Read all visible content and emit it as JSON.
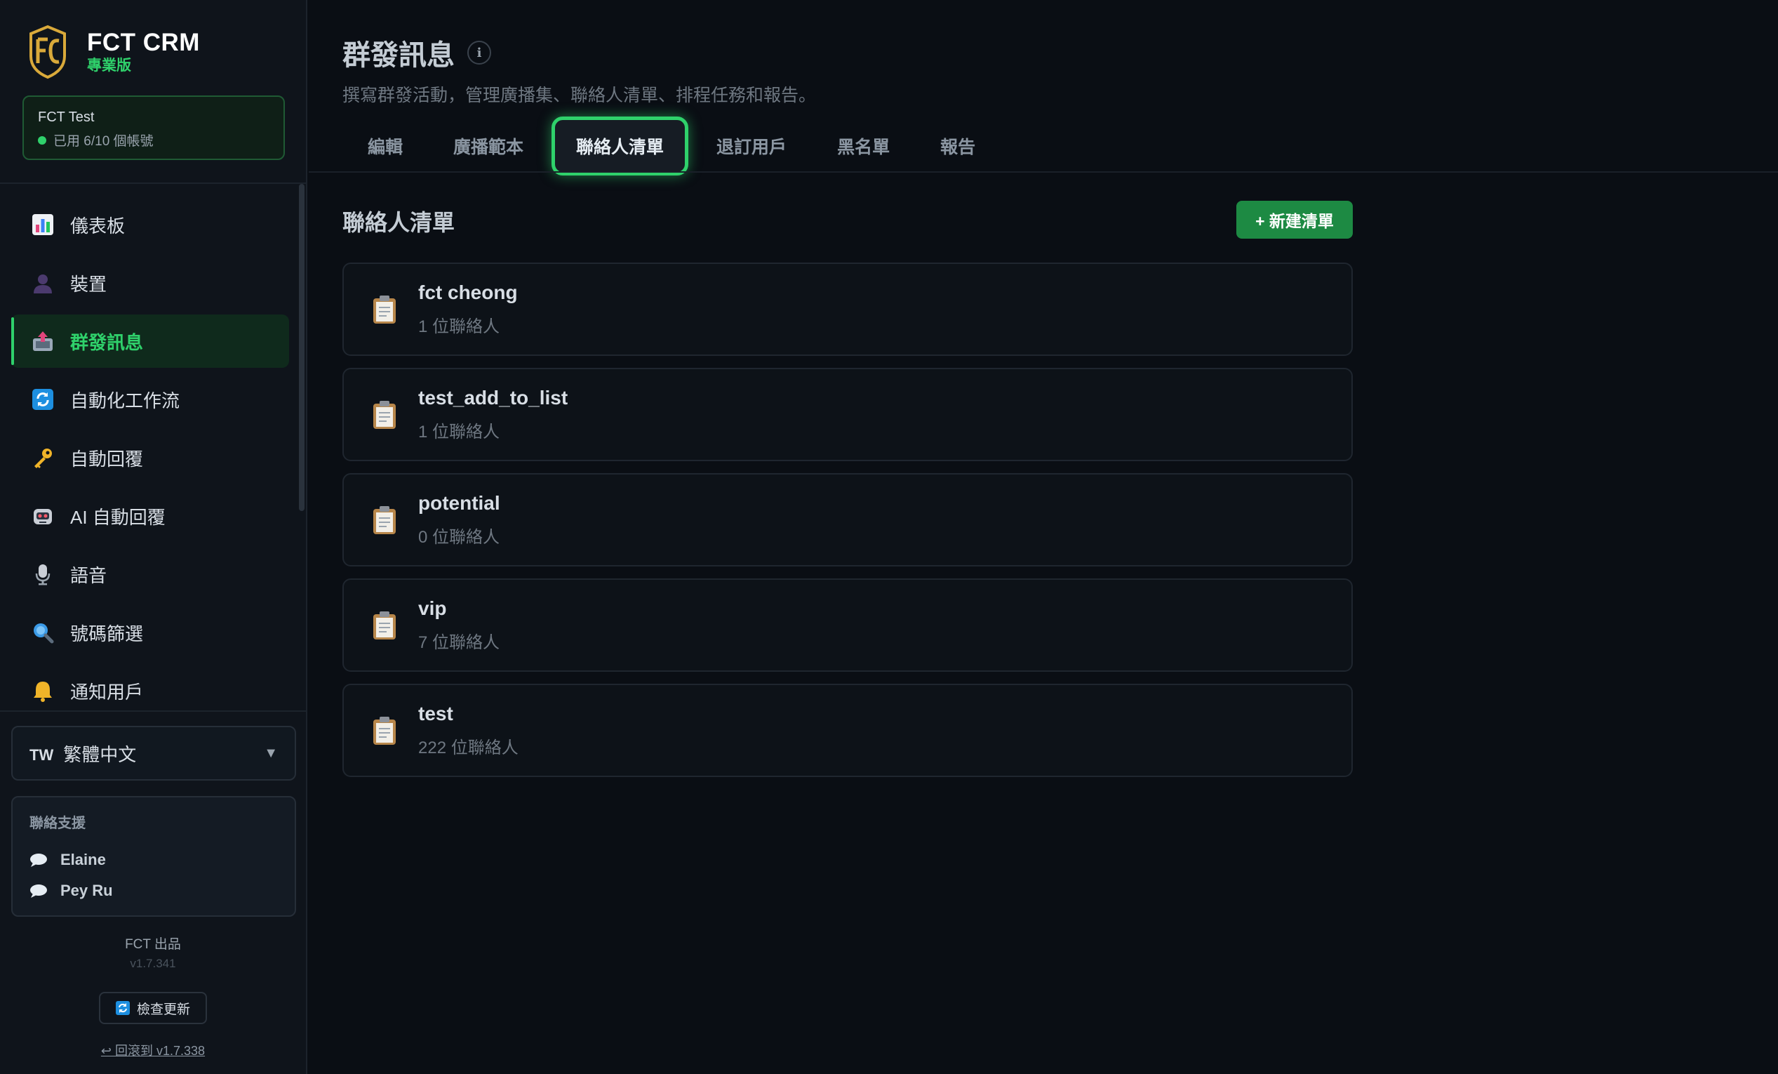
{
  "brand": {
    "title": "FCT CRM",
    "edition": "專業版"
  },
  "account": {
    "name": "FCT Test",
    "status": "已用 6/10 個帳號"
  },
  "nav": [
    {
      "label": "儀表板",
      "icon": "chart-icon"
    },
    {
      "label": "裝置",
      "icon": "person-icon"
    },
    {
      "label": "群發訊息",
      "icon": "outbox-icon",
      "active": true
    },
    {
      "label": "自動化工作流",
      "icon": "refresh-icon"
    },
    {
      "label": "自動回覆",
      "icon": "key-icon"
    },
    {
      "label": "AI 自動回覆",
      "icon": "robot-icon"
    },
    {
      "label": "語音",
      "icon": "microphone-icon"
    },
    {
      "label": "號碼篩選",
      "icon": "magnifier-icon"
    },
    {
      "label": "通知用戶",
      "icon": "bell-icon"
    }
  ],
  "language": {
    "code": "TW",
    "label": "繁體中文"
  },
  "support": {
    "title": "聯絡支援",
    "contacts": [
      "Elaine",
      "Pey Ru"
    ]
  },
  "footer": {
    "brand": "FCT 出品",
    "version": "v1.7.341",
    "update_label": "檢查更新",
    "rollback_label": "↩ 回滾到 v1.7.338"
  },
  "page": {
    "title": "群發訊息",
    "subtitle": "撰寫群發活動，管理廣播集、聯絡人清單、排程任務和報告。"
  },
  "tabs": [
    {
      "label": "編輯"
    },
    {
      "label": "廣播範本"
    },
    {
      "label": "聯絡人清單",
      "active": true
    },
    {
      "label": "退訂用戶"
    },
    {
      "label": "黑名單"
    },
    {
      "label": "報告"
    }
  ],
  "section": {
    "title": "聯絡人清單",
    "new_button": "+ 新建清單"
  },
  "lists": [
    {
      "name": "fct cheong",
      "count": "1 位聯絡人"
    },
    {
      "name": "test_add_to_list",
      "count": "1 位聯絡人"
    },
    {
      "name": "potential",
      "count": "0 位聯絡人"
    },
    {
      "name": "vip",
      "count": "7 位聯絡人"
    },
    {
      "name": "test",
      "count": "222 位聯絡人"
    }
  ],
  "colors": {
    "accent": "#2fd16b",
    "button": "#1d8a43",
    "background": "#0a0e14"
  }
}
